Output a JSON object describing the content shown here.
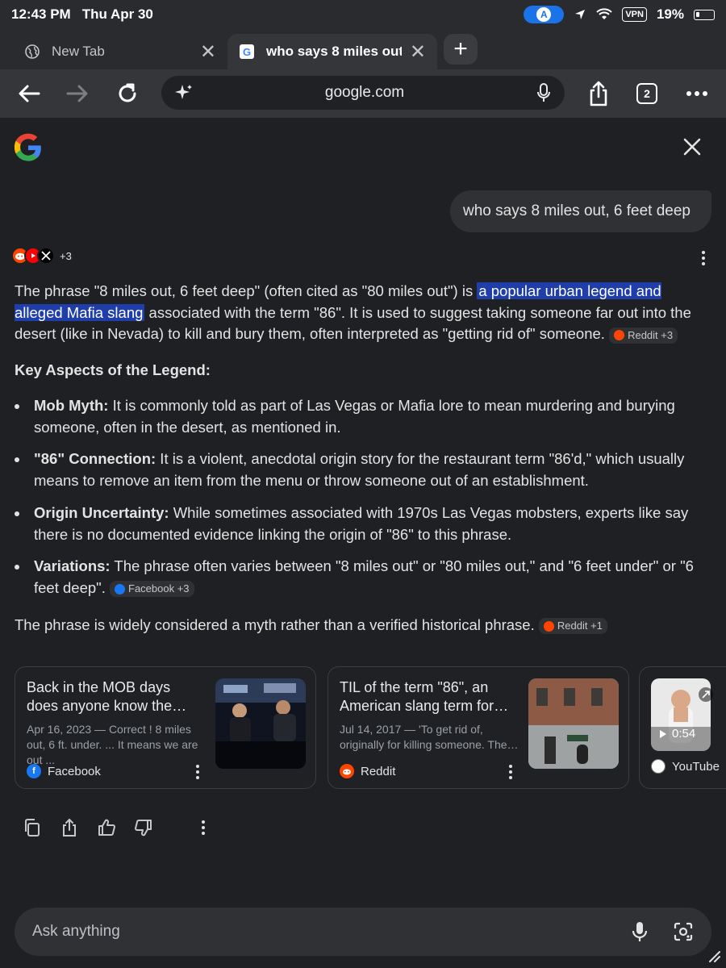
{
  "status": {
    "time": "12:43 PM",
    "date": "Thu Apr 30",
    "vpn": "VPN",
    "battery": "19%",
    "profile_initial": "A"
  },
  "tabs": [
    {
      "title": "New Tab",
      "active": false
    },
    {
      "title": "who says 8 miles out, 6 feet deep",
      "active": true
    }
  ],
  "toolbar": {
    "url": "google.com",
    "tab_count": "2"
  },
  "query": "who says 8 miles out, 6 feet deep",
  "sources_more": "+3",
  "answer": {
    "intro_before": "The phrase \"8 miles out, 6 feet deep\" (often cited as \"80 miles out\") is ",
    "intro_highlight": "a popular urban legend and alleged Mafia slang",
    "intro_after": " associated with the term \"86\". It is used to suggest taking someone far out into the desert (like in Nevada) to kill and bury them, often interpreted as \"getting rid of\" someone.",
    "intro_chip": "Reddit +3",
    "heading": "Key Aspects of the Legend:",
    "bullets": [
      {
        "label": "Mob Myth:",
        "text": " It is commonly told as part of Las Vegas or Mafia lore to mean murdering and burying someone, often in the desert, as mentioned in."
      },
      {
        "label": "\"86\" Connection:",
        "text": " It is a violent, anecdotal origin story for the restaurant term \"86'd,\" which usually means to remove an item from the menu or throw someone out of an establishment."
      },
      {
        "label": "Origin Uncertainty:",
        "text": " While sometimes associated with 1970s Las Vegas mobsters, experts like say there is no documented evidence linking the origin of \"86\" to this phrase."
      },
      {
        "label": "Variations:",
        "text": " The phrase often varies between \"8 miles out\" or \"80 miles out,\" and \"6 feet under\" or \"6 feet deep\".",
        "chip": "Facebook +3"
      }
    ],
    "conclusion": "The phrase is widely considered a myth rather than a verified historical phrase.",
    "conclusion_chip": "Reddit +1"
  },
  "cards": [
    {
      "title": "Back in the MOB days does anyone know the…",
      "snippet": "Apr 16, 2023 — Correct ! 8 miles out, 6 ft. under. ... It means we are out ...",
      "source": "Facebook"
    },
    {
      "title": "TIL of the term \"86\", an American slang term for…",
      "snippet": "Jul 14, 2017 — 'To get rid of, originally for killing someone. The…",
      "source": "Reddit"
    },
    {
      "source": "YouTube",
      "duration": "0:54"
    }
  ],
  "ask": {
    "placeholder": "Ask anything"
  },
  "colors": {
    "highlight": "#1f3eaa",
    "reddit": "#ff4500",
    "facebook": "#1877f2",
    "youtube": "#ff0000",
    "accent": "#1a73e8"
  }
}
